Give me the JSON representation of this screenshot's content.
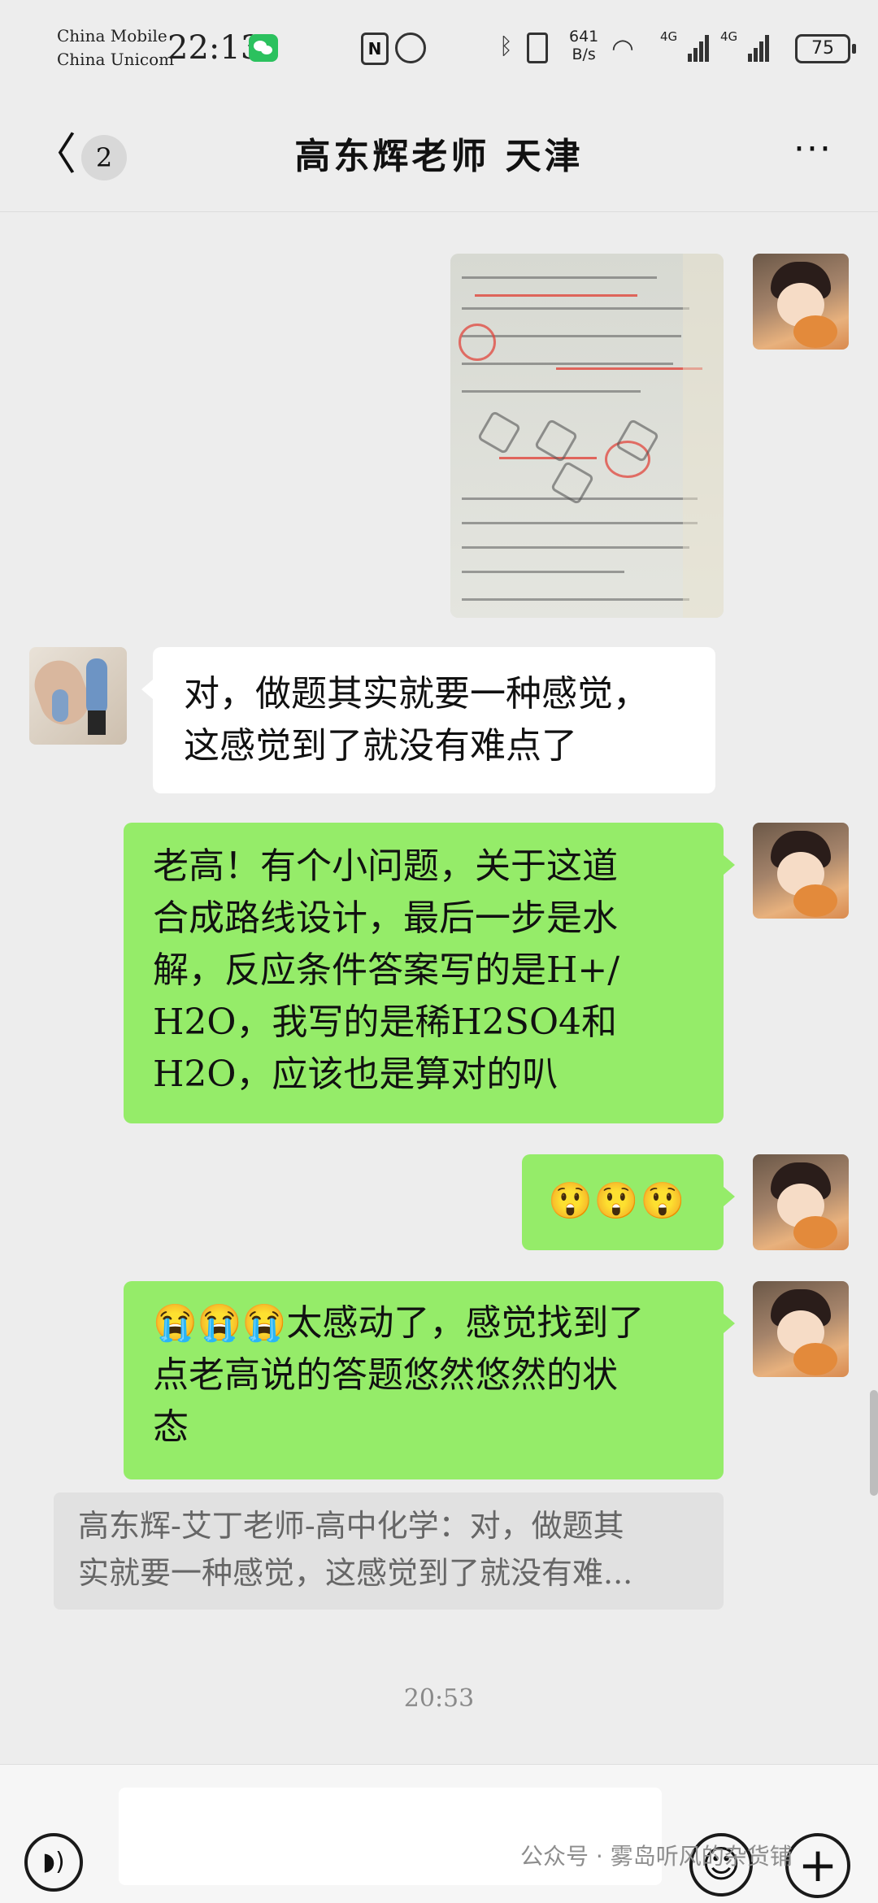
{
  "status_bar": {
    "carrier1": "China Mobile",
    "carrier2": "China Unicom",
    "time": "22:13",
    "net_speed_value": "641",
    "net_speed_unit": "B/s",
    "signal1": "4G",
    "signal2": "4G",
    "battery": "75"
  },
  "header": {
    "unread_count": "2",
    "title": "高东辉老师 天津",
    "more": "···"
  },
  "messages": [
    {
      "from": "me",
      "type": "image"
    },
    {
      "from": "other",
      "type": "text",
      "lines": [
        "对，做题其实就要一种感觉，",
        "这感觉到了就没有难点了"
      ]
    },
    {
      "from": "me",
      "type": "text",
      "lines": [
        "老高！有个小问题，关于这道",
        "合成路线设计，最后一步是水",
        "解，反应条件答案写的是H+/",
        "H2O，我写的是稀H2SO4和",
        "H2O，应该也是算对的叭"
      ]
    },
    {
      "from": "me",
      "type": "text",
      "lines": [
        "😲😲😲"
      ]
    },
    {
      "from": "me",
      "type": "text",
      "lines": [
        "😭😭😭太感动了，感觉找到了",
        "点老高说的答题悠然悠然的状",
        "态"
      ]
    }
  ],
  "quote": {
    "lines": [
      "高东辉-艾丁老师-高中化学：对，做题其",
      "实就要一种感觉，这感觉到了就没有难..."
    ]
  },
  "timestamp": "20:53",
  "input_bar": {
    "voice_icon": "voice-icon",
    "emoji_icon": "emoji-icon",
    "plus_icon": "plus-icon"
  },
  "watermark": "公众号 · 雾岛听风的杂货铺",
  "colors": {
    "background": "#ededed",
    "my_bubble": "#95ec69",
    "other_bubble": "#ffffff",
    "wechat_green": "#2bc15e"
  }
}
